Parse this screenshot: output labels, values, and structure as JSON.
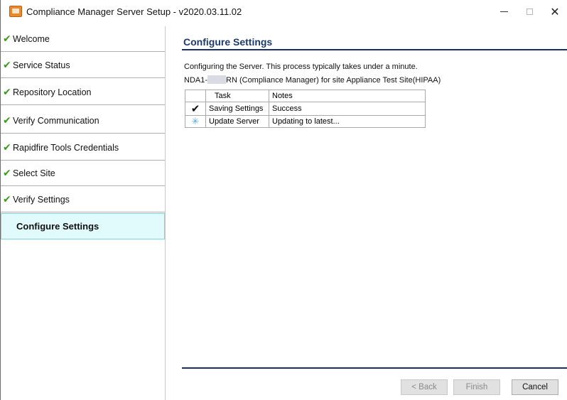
{
  "window": {
    "title": "Compliance Manager Server Setup - v2020.03.11.02",
    "minimize": "—",
    "close": "✕"
  },
  "sidebar": {
    "check_glyph": "✔",
    "items": [
      {
        "label": "Welcome",
        "done": true
      },
      {
        "label": "Service Status",
        "done": true
      },
      {
        "label": "Repository Location",
        "done": true
      },
      {
        "label": "Verify Communication",
        "done": true
      },
      {
        "label": "Rapidfire Tools Credentials",
        "done": true
      },
      {
        "label": "Select Site",
        "done": true
      },
      {
        "label": "Verify Settings",
        "done": true
      },
      {
        "label": "Configure Settings",
        "done": false,
        "active": true
      }
    ]
  },
  "main": {
    "heading": "Configure Settings",
    "description": "Configuring the Server. This process typically takes under a minute.",
    "server_prefix": "NDA1-",
    "server_suffix": "RN (Compliance Manager) for site Appliance Test Site(HIPAA)",
    "table": {
      "headers": [
        "",
        "Task",
        "Notes"
      ],
      "rows": [
        {
          "status_icon": "check-icon",
          "glyph": "✔",
          "task": "Saving Settings",
          "notes": "Success"
        },
        {
          "status_icon": "spinner-icon",
          "glyph": "✳",
          "task": "Update Server",
          "notes": "Updating to latest..."
        }
      ]
    }
  },
  "footer": {
    "back_label": "< Back",
    "finish_label": "Finish",
    "cancel_label": "Cancel"
  },
  "colors": {
    "accent_heading": "#1c3b6b",
    "check_green": "#3c9a1e",
    "active_step_bg": "#e1fbfc"
  }
}
